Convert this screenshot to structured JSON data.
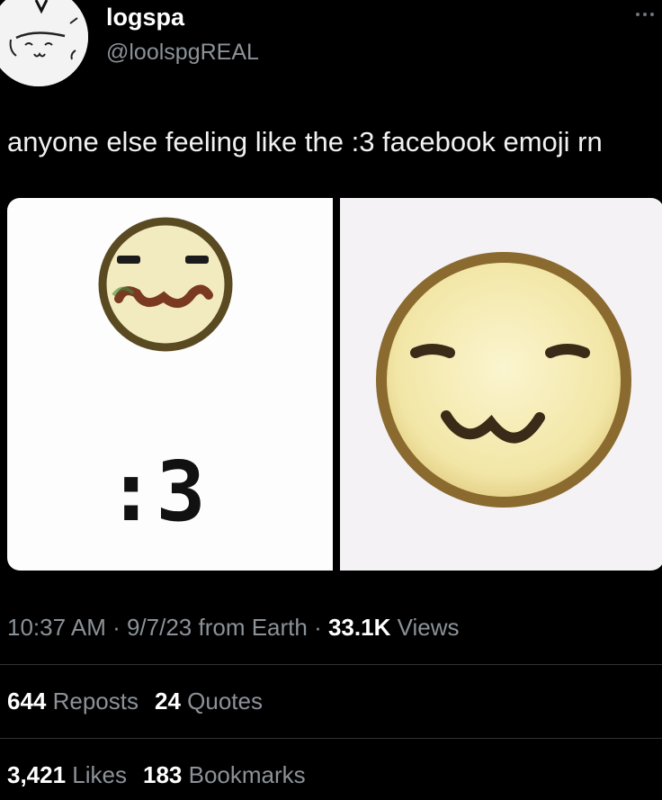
{
  "user": {
    "name": "logspa",
    "handle": "@loolspgREAL"
  },
  "tweet": {
    "text": "anyone else feeling like the :3 facebook emoji rn",
    "media_left_caption": ":3"
  },
  "meta": {
    "time": "10:37 AM",
    "sep1": " · ",
    "date": "9/7/23",
    "source": " from Earth",
    "sep2": " · ",
    "views_count": "33.1K",
    "views_label": " Views"
  },
  "stats": {
    "reposts_count": "644",
    "reposts_label": " Reposts",
    "quotes_count": "24",
    "quotes_label": " Quotes",
    "likes_count": "3,421",
    "likes_label": " Likes",
    "bookmarks_count": "183",
    "bookmarks_label": " Bookmarks"
  },
  "icons": {
    "more": "more-horizontal-icon"
  },
  "colors": {
    "background": "#000000",
    "primary_text": "#e7e9ea",
    "secondary_text": "#8b9298",
    "divider": "#2f3336",
    "emoji_face": "#f6ecb4",
    "emoji_outline": "#8a6a2e"
  }
}
